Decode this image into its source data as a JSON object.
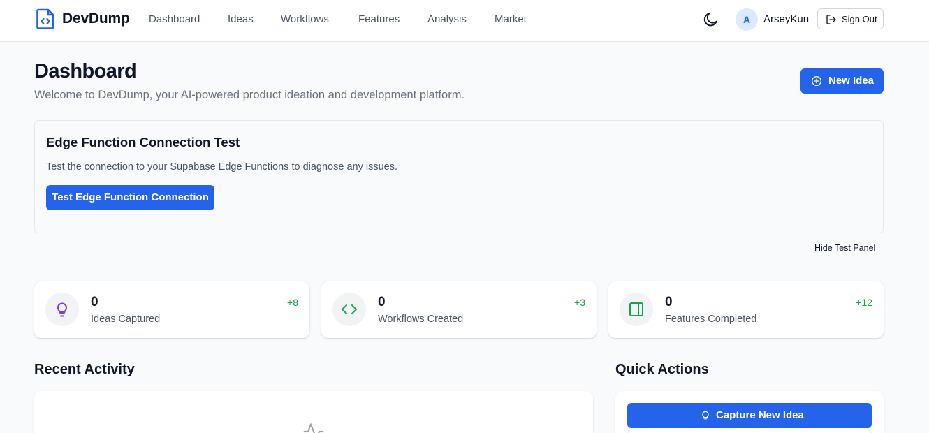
{
  "header": {
    "brand": "DevDump",
    "nav": [
      "Dashboard",
      "Ideas",
      "Workflows",
      "Features",
      "Analysis",
      "Market"
    ],
    "user": {
      "initial": "A",
      "name": "ArseyKun"
    },
    "signout_label": "Sign Out"
  },
  "page": {
    "title": "Dashboard",
    "subtitle": "Welcome to DevDump, your AI-powered product ideation and development platform.",
    "new_idea_label": "New Idea"
  },
  "test_panel": {
    "title": "Edge Function Connection Test",
    "description": "Test the connection to your Supabase Edge Functions to diagnose any issues.",
    "button_label": "Test Edge Function Connection",
    "hide_label": "Hide Test Panel"
  },
  "stats": [
    {
      "value": "0",
      "label": "Ideas Captured",
      "delta": "+8",
      "icon": "lightbulb-icon",
      "icon_color": "#7c3aed"
    },
    {
      "value": "0",
      "label": "Workflows Created",
      "delta": "+3",
      "icon": "code-icon",
      "icon_color": "#16a34a"
    },
    {
      "value": "0",
      "label": "Features Completed",
      "delta": "+12",
      "icon": "panel-icon",
      "icon_color": "#16a34a"
    }
  ],
  "recent_activity": {
    "title": "Recent Activity",
    "icon": "activity-icon"
  },
  "quick_actions": {
    "title": "Quick Actions",
    "capture_label": "Capture New Idea"
  },
  "colors": {
    "primary": "#2563eb",
    "positive": "#16a34a",
    "background": "#f8fafc"
  }
}
